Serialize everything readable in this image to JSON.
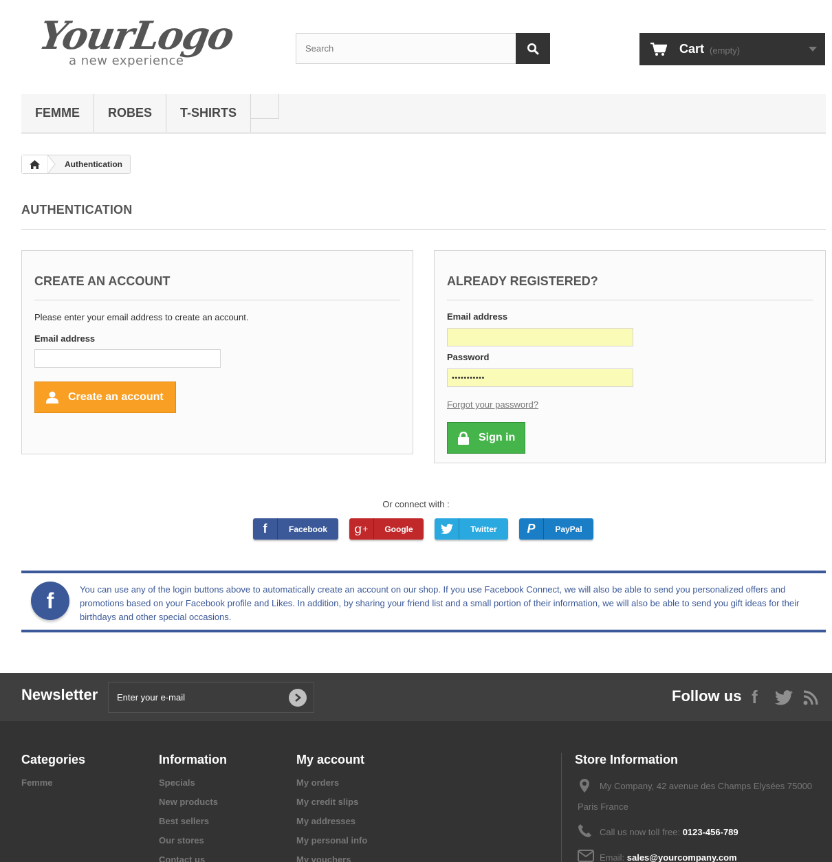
{
  "header": {
    "logo_main": "YourLogo",
    "logo_tagline": "a new experience",
    "search_placeholder": "Search",
    "cart_label": "Cart",
    "cart_status": "(empty)"
  },
  "menu": [
    "FEMME",
    "ROBES",
    "T-SHIRTS"
  ],
  "breadcrumb": {
    "current": "Authentication"
  },
  "page_title": "AUTHENTICATION",
  "create_account": {
    "title": "CREATE AN ACCOUNT",
    "note": "Please enter your email address to create an account.",
    "email_label": "Email address",
    "email_value": "",
    "button": "Create an account"
  },
  "login": {
    "title": "ALREADY REGISTERED?",
    "email_label": "Email address",
    "email_value": "",
    "password_label": "Password",
    "password_value": "•••••••••••",
    "forgot": "Forgot your password?",
    "button": "Sign in"
  },
  "social": {
    "prompt": "Or connect with :",
    "buttons": [
      {
        "name": "Facebook",
        "color": "#3b5998"
      },
      {
        "name": "Google",
        "color": "#c0282a"
      },
      {
        "name": "Twitter",
        "color": "#2aa9e0"
      },
      {
        "name": "PayPal",
        "color": "#1a7ec6"
      }
    ],
    "info": "You can use any of the login buttons above to automatically create an account on our shop. If you use Facebook Connect, we will also be able to send you personalized offers and promotions based on your Facebook profile and Likes. In addition, by sharing your friend list and a small portion of their information, we will also be able to send you gift ideas for their birthdays and other special occasions."
  },
  "footer": {
    "newsletter_title": "Newsletter",
    "newsletter_placeholder": "Enter your e-mail",
    "follow_title": "Follow us",
    "categories": {
      "title": "Categories",
      "links": [
        "Femme"
      ]
    },
    "information": {
      "title": "Information",
      "links": [
        "Specials",
        "New products",
        "Best sellers",
        "Our stores",
        "Contact us"
      ]
    },
    "my_account": {
      "title": "My account",
      "links": [
        "My orders",
        "My credit slips",
        "My addresses",
        "My personal info",
        "My vouchers"
      ]
    },
    "store": {
      "title": "Store Information",
      "address_line1": "My Company, 42 avenue des Champs Elysées 75000",
      "address_line2": "Paris France",
      "phone_label": "Call us now toll free:",
      "phone": "0123-456-789",
      "email_label": "Email:",
      "email": "sales@yourcompany.com"
    }
  }
}
